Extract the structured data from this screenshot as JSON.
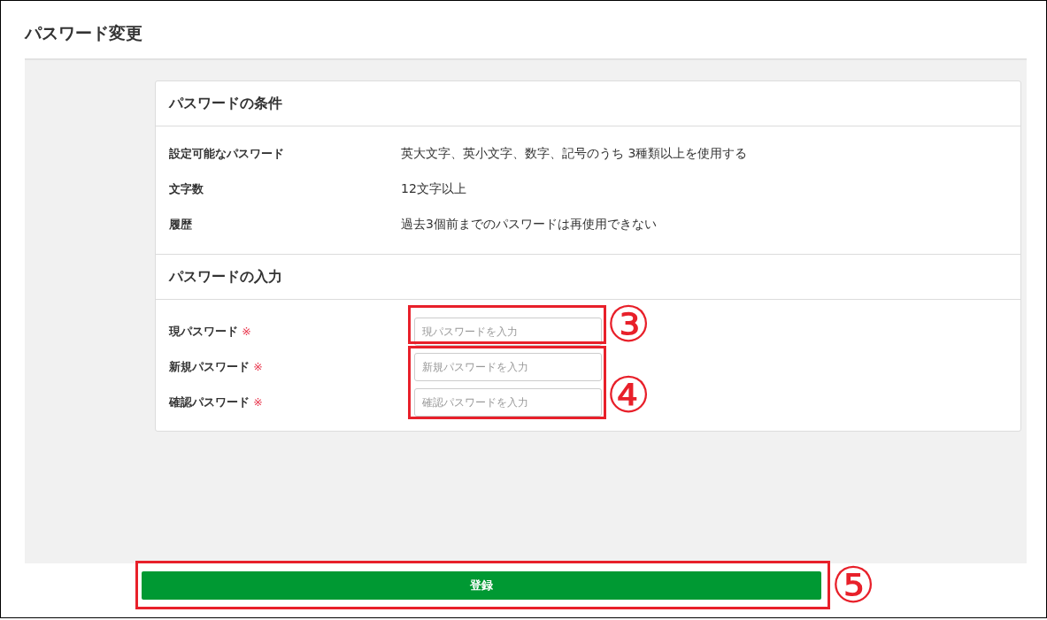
{
  "title": "パスワード変更",
  "conditions": {
    "heading": "パスワードの条件",
    "rows": [
      {
        "label": "設定可能なパスワード",
        "value": "英大文字、英小文字、数字、記号のうち 3種類以上を使用する"
      },
      {
        "label": "文字数",
        "value": "12文字以上"
      },
      {
        "label": "履歴",
        "value": "過去3個前までのパスワードは再使用できない"
      }
    ]
  },
  "input": {
    "heading": "パスワードの入力",
    "fields": [
      {
        "label": "現パスワード",
        "required_mark": "※",
        "placeholder": "現パスワードを入力"
      },
      {
        "label": "新規パスワード",
        "required_mark": "※",
        "placeholder": "新規パスワードを入力"
      },
      {
        "label": "確認パスワード",
        "required_mark": "※",
        "placeholder": "確認パスワードを入力"
      }
    ]
  },
  "submit_button": "登録",
  "annotations": [
    {
      "number": "③"
    },
    {
      "number": "④"
    },
    {
      "number": "⑤"
    }
  ]
}
